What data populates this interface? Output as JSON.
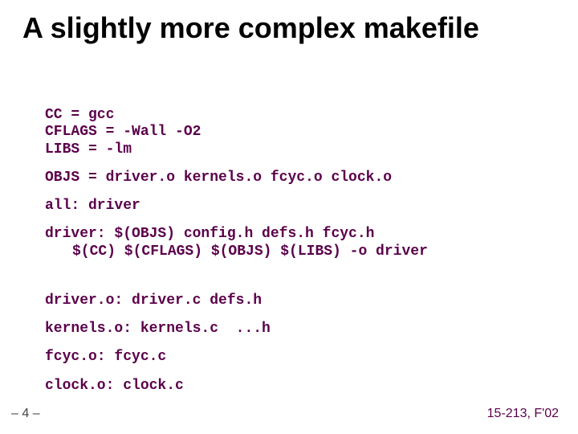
{
  "title": "A slightly more complex makefile",
  "code": {
    "l1": "CC = gcc",
    "l2": "CFLAGS = -Wall -O2",
    "l3": "LIBS = -lm",
    "l4": "OBJS = driver.o kernels.o fcyc.o clock.o",
    "l5": "all: driver",
    "l6": "driver: $(OBJS) config.h defs.h fcyc.h",
    "l7": "$(CC) $(CFLAGS) $(OBJS) $(LIBS) -o driver",
    "l8": "driver.o: driver.c defs.h",
    "l9": "kernels.o: kernels.c  ...h",
    "l10": "fcyc.o: fcyc.c",
    "l11": "clock.o: clock.c"
  },
  "page_number": "– 4 –",
  "footer_right": "15-213, F'02"
}
